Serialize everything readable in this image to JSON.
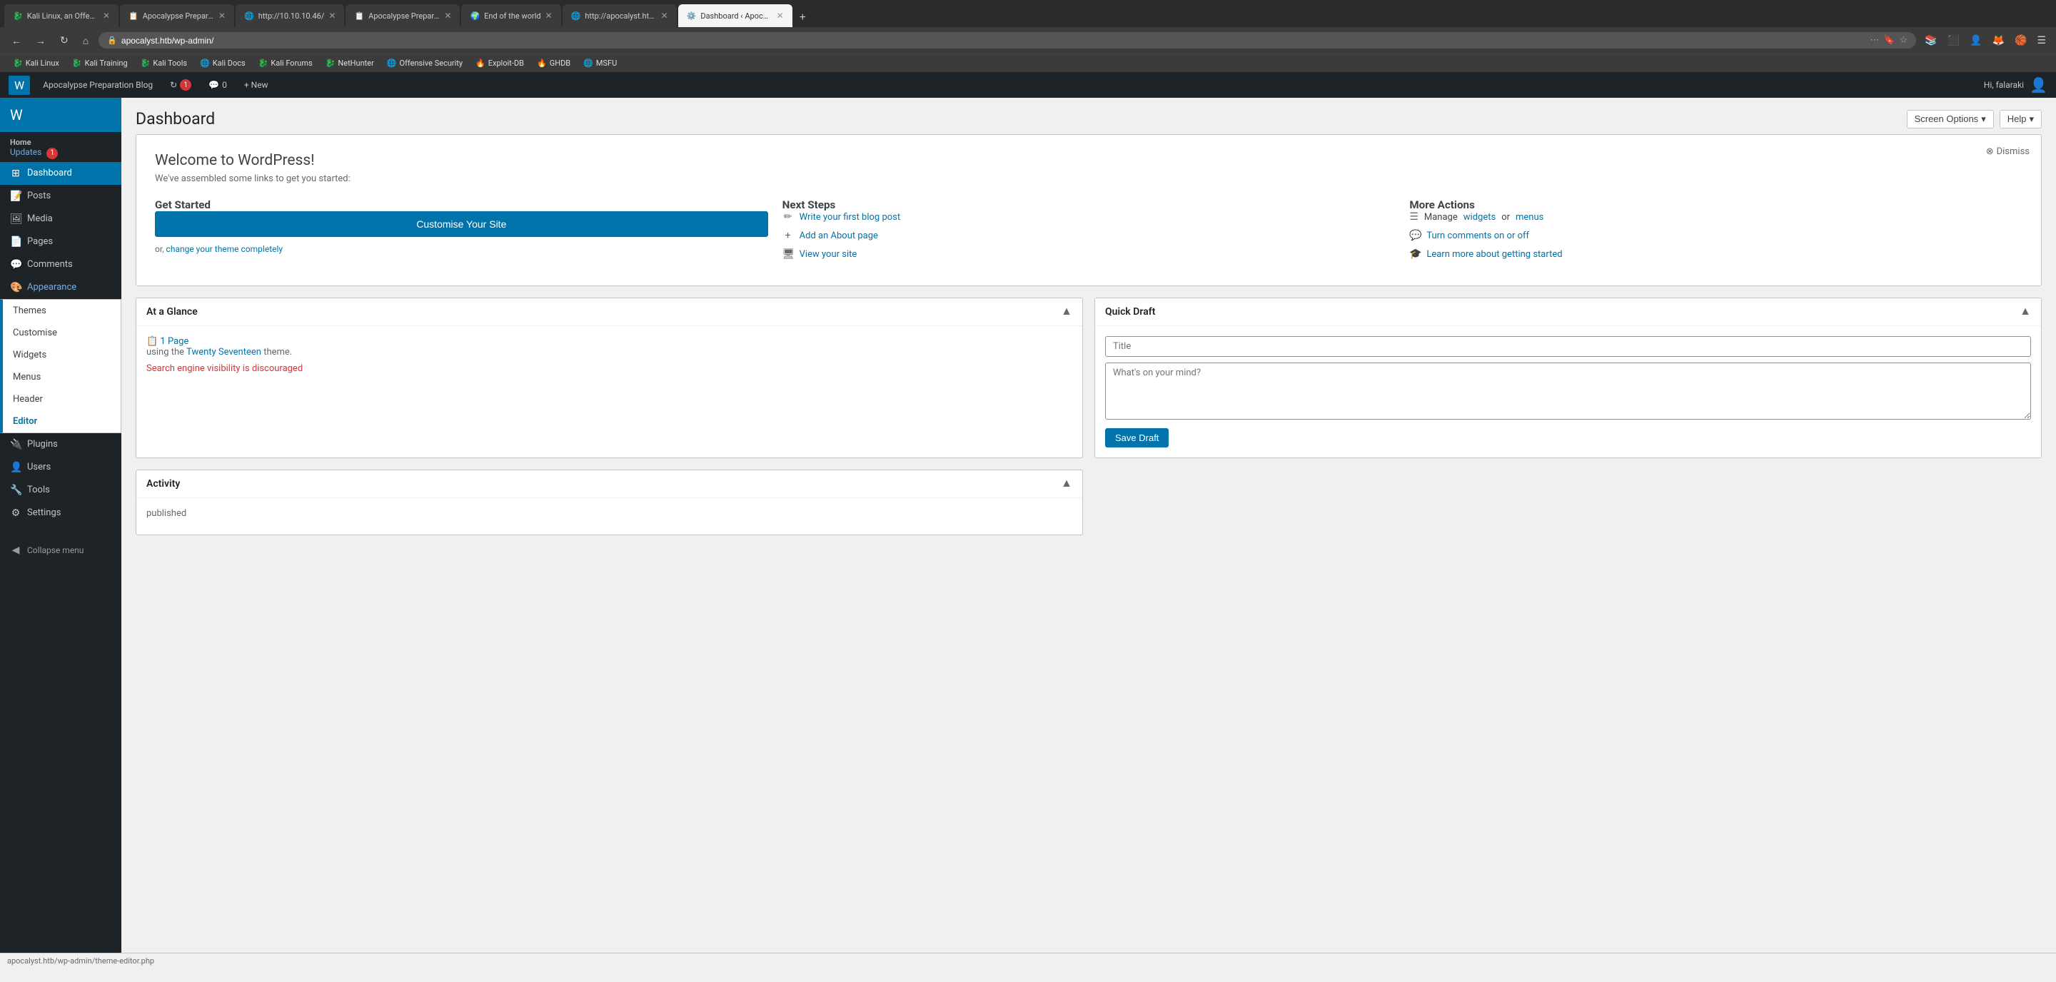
{
  "browser": {
    "tabs": [
      {
        "id": "tab1",
        "title": "Kali Linux, an Offensive Se",
        "active": false,
        "favicon": "🐉"
      },
      {
        "id": "tab2",
        "title": "Apocalypse Preparation B",
        "active": false,
        "favicon": "📋"
      },
      {
        "id": "tab3",
        "title": "http://10.10.10.46/",
        "active": false,
        "favicon": "🌐"
      },
      {
        "id": "tab4",
        "title": "Apocalypse Preparation B",
        "active": false,
        "favicon": "📋"
      },
      {
        "id": "tab5",
        "title": "End of the world",
        "active": false,
        "favicon": "🌍"
      },
      {
        "id": "tab6",
        "title": "http://apocalyst.htb/Right",
        "active": false,
        "favicon": "🌐"
      },
      {
        "id": "tab7",
        "title": "Dashboard ‹ Apocalypse P",
        "active": true,
        "favicon": "⚙️"
      }
    ],
    "address": "apocalyst.htb/wp-admin/",
    "bookmarks": [
      {
        "label": "Kali Linux",
        "icon": "🐉"
      },
      {
        "label": "Kali Training",
        "icon": "🐉"
      },
      {
        "label": "Kali Tools",
        "icon": "🐉"
      },
      {
        "label": "Kali Docs",
        "icon": "🌐"
      },
      {
        "label": "Kali Forums",
        "icon": "🐉"
      },
      {
        "label": "NetHunter",
        "icon": "🐉"
      },
      {
        "label": "Offensive Security",
        "icon": "🌐"
      },
      {
        "label": "Exploit-DB",
        "icon": "🔥"
      },
      {
        "label": "GHDB",
        "icon": "🔥"
      },
      {
        "label": "MSFU",
        "icon": "🌐"
      }
    ]
  },
  "wp_admin_bar": {
    "logo": "W",
    "site_name": "Apocalypse Preparation Blog",
    "updates_count": "1",
    "comments_count": "0",
    "new_label": "+ New",
    "user_label": "Hi, falaraki"
  },
  "sidebar": {
    "home_label": "Home",
    "updates_label": "Updates",
    "updates_count": "1",
    "menu_items": [
      {
        "id": "dashboard",
        "icon": "⊞",
        "label": "Dashboard",
        "active": true
      },
      {
        "id": "posts",
        "icon": "📝",
        "label": "Posts",
        "active": false
      },
      {
        "id": "media",
        "icon": "🖼",
        "label": "Media",
        "active": false
      },
      {
        "id": "pages",
        "icon": "📄",
        "label": "Pages",
        "active": false
      },
      {
        "id": "comments",
        "icon": "💬",
        "label": "Comments",
        "active": false
      },
      {
        "id": "appearance",
        "icon": "🎨",
        "label": "Appearance",
        "active": true,
        "highlighted": true
      },
      {
        "id": "plugins",
        "icon": "🔌",
        "label": "Plugins",
        "active": false
      },
      {
        "id": "users",
        "icon": "👤",
        "label": "Users",
        "active": false
      },
      {
        "id": "tools",
        "icon": "🔧",
        "label": "Tools",
        "active": false
      },
      {
        "id": "settings",
        "icon": "⚙",
        "label": "Settings",
        "active": false
      }
    ],
    "collapse_label": "Collapse menu"
  },
  "appearance_dropdown": {
    "items": [
      {
        "label": "Themes",
        "active": false
      },
      {
        "label": "Customise",
        "active": false
      },
      {
        "label": "Widgets",
        "active": false
      },
      {
        "label": "Menus",
        "active": false
      },
      {
        "label": "Header",
        "active": false
      },
      {
        "label": "Editor",
        "active": true
      }
    ]
  },
  "header": {
    "title": "Dashboard",
    "screen_options": "Screen Options",
    "help": "Help"
  },
  "welcome_panel": {
    "title": "Welcome to WordPress!",
    "subtitle": "We've assembled some links to get you started:",
    "dismiss": "Dismiss",
    "get_started": {
      "heading": "Get Started",
      "button": "Customise Your Site",
      "or_text": "or,",
      "change_link": "change your theme completely"
    },
    "next_steps": {
      "heading": "Next Steps",
      "links": [
        {
          "icon": "✏",
          "label": "Write your first blog post"
        },
        {
          "icon": "+",
          "label": "Add an About page"
        },
        {
          "icon": "🖥",
          "label": "View your site"
        }
      ]
    },
    "more_actions": {
      "heading": "More Actions",
      "links": [
        {
          "icon": "☰",
          "label_pre": "Manage ",
          "link1": "widgets",
          "middle": " or ",
          "link2": "menus"
        },
        {
          "icon": "💬",
          "label": "Turn comments on or off"
        },
        {
          "icon": "🎓",
          "label": "Learn more about getting started"
        }
      ]
    }
  },
  "at_a_glance": {
    "title": "At a Glance",
    "page_link": "1 Page",
    "theme_text": "using the",
    "theme_link": "Twenty Seventeen",
    "theme_suffix": "theme.",
    "search_note": "Search engine visibility is discouraged"
  },
  "quick_draft": {
    "title": "Quick Draft",
    "title_placeholder": "Title",
    "body_placeholder": "What's on your mind?",
    "save_label": "Save Draft"
  },
  "activity": {
    "title": "Activity",
    "content": "published"
  },
  "status_bar": {
    "text": "apocalyst.htb/wp-admin/theme-editor.php"
  }
}
